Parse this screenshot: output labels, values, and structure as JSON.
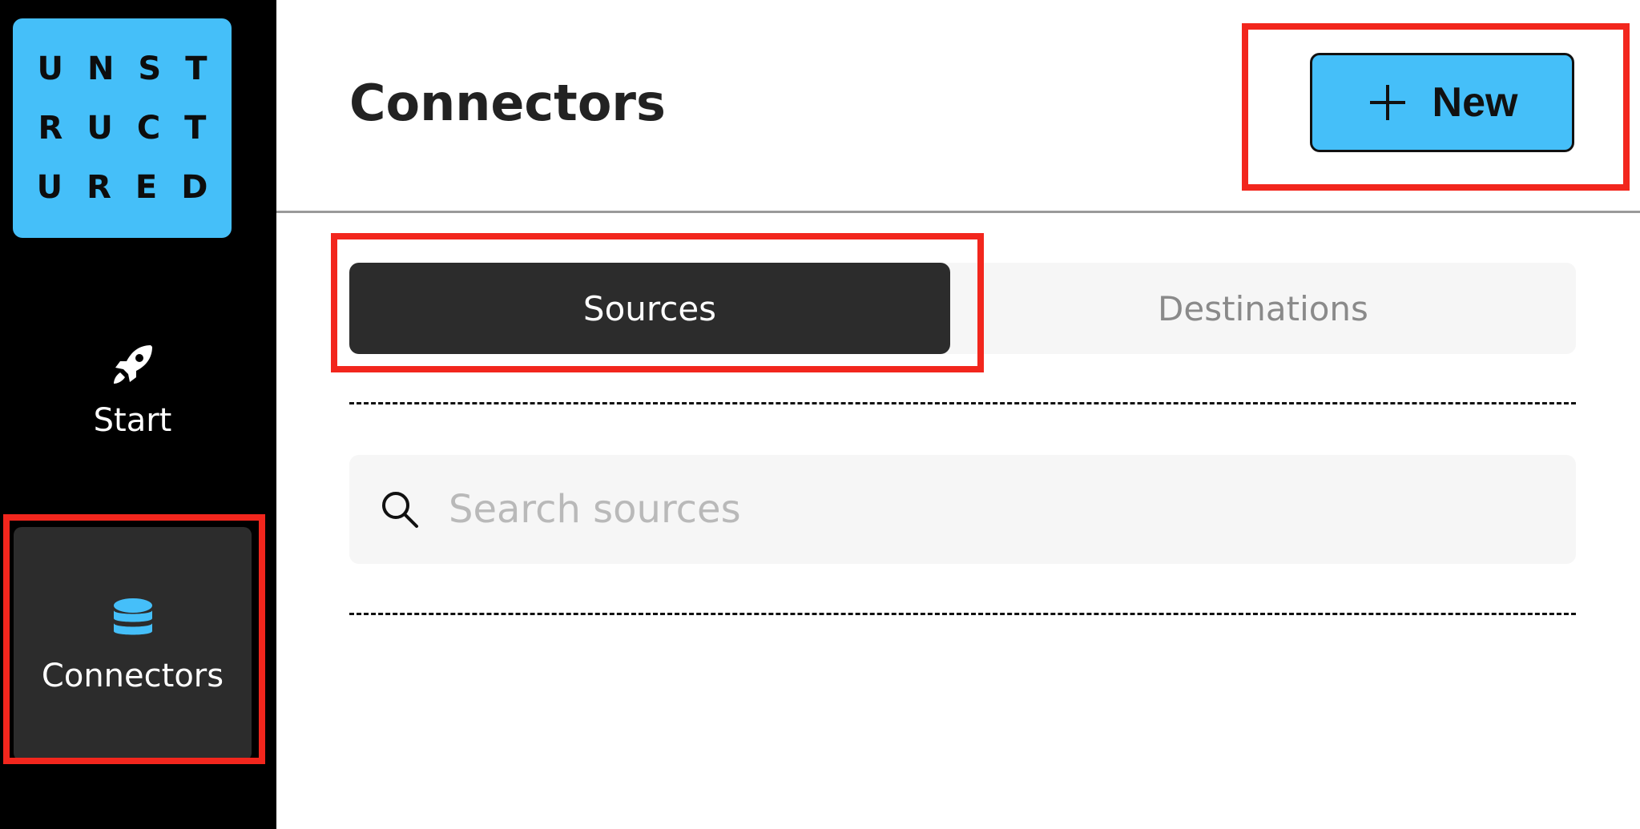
{
  "sidebar": {
    "logo": {
      "lines": [
        "UNST",
        "RUCT",
        "URED"
      ]
    },
    "items": [
      {
        "label": "Start",
        "icon": "rocket-icon",
        "active": false
      },
      {
        "label": "Connectors",
        "icon": "database-icon",
        "active": true
      }
    ]
  },
  "header": {
    "title": "Connectors",
    "new_button_label": "New"
  },
  "tabs": [
    {
      "label": "Sources",
      "active": true
    },
    {
      "label": "Destinations",
      "active": false
    }
  ],
  "search": {
    "placeholder": "Search sources",
    "value": ""
  },
  "colors": {
    "accent": "#45bff9",
    "sidebar_bg": "#000000",
    "active_bg": "#2c2c2c",
    "highlight": "#f2261d"
  }
}
